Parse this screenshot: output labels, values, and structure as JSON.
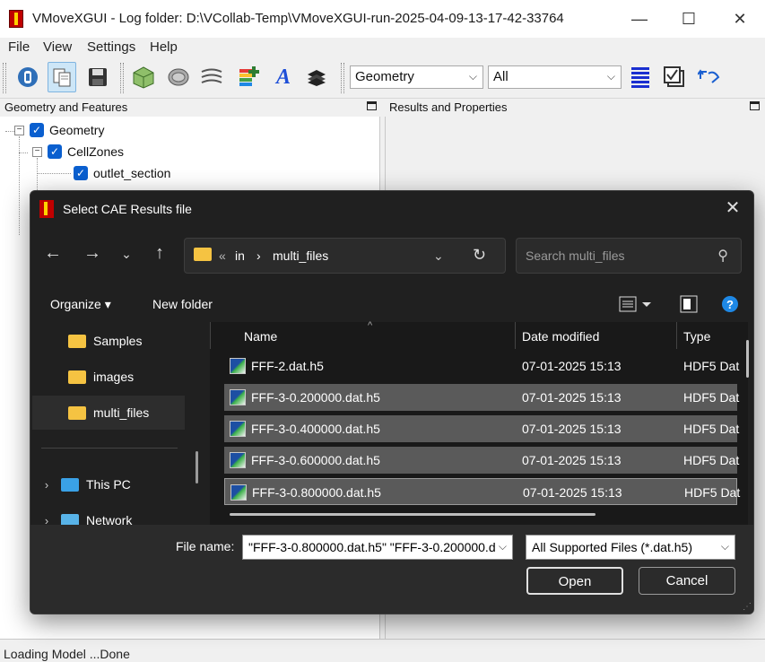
{
  "window": {
    "title": "VMoveXGUI - Log folder: D:\\VCollab-Temp\\VMoveXGUI-run-2025-04-09-13-17-42-33764",
    "minimize": "—",
    "maximize": "☐",
    "close": "✕"
  },
  "menu": [
    "File",
    "View",
    "Settings",
    "Help"
  ],
  "toolbar": {
    "combo1": "Geometry",
    "combo2": "All",
    "font_icon_text": "A"
  },
  "panels": {
    "left_title": "Geometry and Features",
    "right_title": "Results and Properties"
  },
  "tree": [
    {
      "label": "Geometry"
    },
    {
      "label": "CellZones"
    },
    {
      "label": "outlet_section"
    }
  ],
  "status": "Loading Model ...Done",
  "dialog": {
    "title": "Select CAE Results file",
    "close": "✕",
    "breadcrumb": {
      "prefix": "«",
      "parent": "in",
      "sep": "›",
      "current": "multi_files"
    },
    "search_placeholder": "Search multi_files",
    "organize": "Organize ▾",
    "new_folder": "New folder",
    "nav": [
      {
        "label": "Samples"
      },
      {
        "label": "images"
      },
      {
        "label": "multi_files"
      },
      {
        "label": "This PC"
      },
      {
        "label": "Network"
      }
    ],
    "columns": {
      "name": "Name",
      "date": "Date modified",
      "type": "Type"
    },
    "files": [
      {
        "name": "FFF-2.dat.h5",
        "date": "07-01-2025 15:13",
        "type": "HDF5 Dat"
      },
      {
        "name": "FFF-3-0.200000.dat.h5",
        "date": "07-01-2025 15:13",
        "type": "HDF5 Dat"
      },
      {
        "name": "FFF-3-0.400000.dat.h5",
        "date": "07-01-2025 15:13",
        "type": "HDF5 Dat"
      },
      {
        "name": "FFF-3-0.600000.dat.h5",
        "date": "07-01-2025 15:13",
        "type": "HDF5 Dat"
      },
      {
        "name": "FFF-3-0.800000.dat.h5",
        "date": "07-01-2025 15:13",
        "type": "HDF5 Dat"
      }
    ],
    "file_name_label": "File name:",
    "file_name_value": "\"FFF-3-0.800000.dat.h5\" \"FFF-3-0.200000.d",
    "filter": "All Supported Files (*.dat.h5)",
    "open": "Open",
    "cancel": "Cancel"
  }
}
